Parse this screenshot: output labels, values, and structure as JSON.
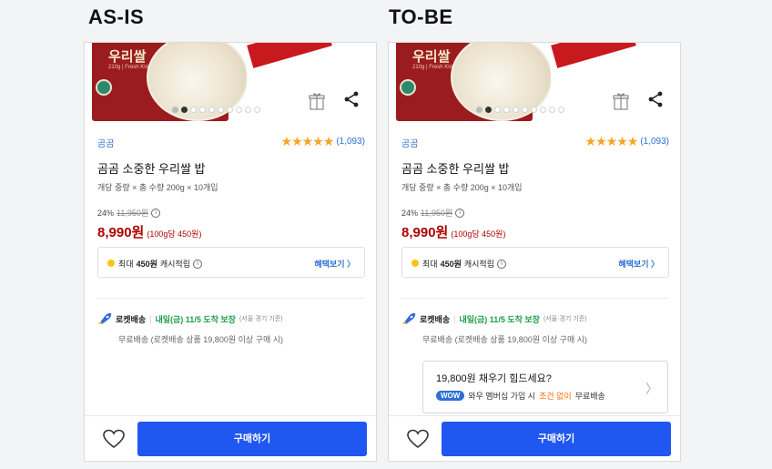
{
  "panels": [
    {
      "heading": "AS-IS",
      "image": {
        "brand": "우리쌀",
        "brand_badge": "밥",
        "brand_sub": "210g | Fresh Kimchi"
      },
      "carousel": {
        "total": 10,
        "current": 1
      },
      "seller": "곰곰",
      "rating": {
        "stars": "★★★★★",
        "count": "(1,093)"
      },
      "title": "곰곰 소중한 우리쌀 밥",
      "spec": "개당 중량 × 총 수량 200g × 10개입",
      "discount": {
        "rate": "24%",
        "original": "11,950원",
        "info": "i"
      },
      "price": {
        "sale": "8,990원",
        "unit": "(100g당 450원)"
      },
      "cash": {
        "prefix": "최대",
        "amount": "450원",
        "label": "캐시적립",
        "info": "i",
        "link": "혜택보기 〉"
      },
      "delivery": {
        "rocket": "로켓배송",
        "sep": "|",
        "arrival": "내일(금) 11/5 도착 보장",
        "region": "(서울·경기 기준)",
        "free": "무료배송 (로켓배송 상품 19,800원 이상 구매 시)"
      },
      "buy_label": "구매하기"
    },
    {
      "heading": "TO-BE",
      "image": {
        "brand": "우리쌀",
        "brand_badge": "밥",
        "brand_sub": "210g | Fresh Kimchi"
      },
      "carousel": {
        "total": 10,
        "current": 1
      },
      "seller": "곰곰",
      "rating": {
        "stars": "★★★★★",
        "count": "(1,093)"
      },
      "title": "곰곰 소중한 우리쌀 밥",
      "spec": "개당 중량 × 총 수량 200g × 10개입",
      "discount": {
        "rate": "24%",
        "original": "11,950원",
        "info": "i"
      },
      "price": {
        "sale": "8,990원",
        "unit": "(100g당 450원)"
      },
      "cash": {
        "prefix": "최대",
        "amount": "450원",
        "label": "캐시적립",
        "info": "i",
        "link": "혜택보기 〉"
      },
      "delivery": {
        "rocket": "로켓배송",
        "sep": "|",
        "arrival": "내일(금) 11/5 도착 보장",
        "region": "(서울·경기 기준)",
        "free": "무료배송 (로켓배송 상품 19,800원 이상 구매 시)"
      },
      "upsell": {
        "question": "19,800원 채우기 힘드세요?",
        "badge": "WOW",
        "pre": "와우 멤버십 가입 시",
        "highlight": "조건 없이",
        "post": "무료배송",
        "chevron": "〉"
      },
      "buy_label": "구매하기"
    }
  ],
  "colors": {
    "brand_blue": "#1f57f0",
    "price_red": "#ae0000",
    "arrival_green": "#1a9e47",
    "star_gold": "#f5a623",
    "link_blue": "#2f6fd6",
    "highlight_orange": "#ff6a00"
  },
  "icons": {
    "gift": "gift-icon",
    "share": "share-icon",
    "heart": "heart-icon",
    "rocket": "rocket-icon"
  }
}
